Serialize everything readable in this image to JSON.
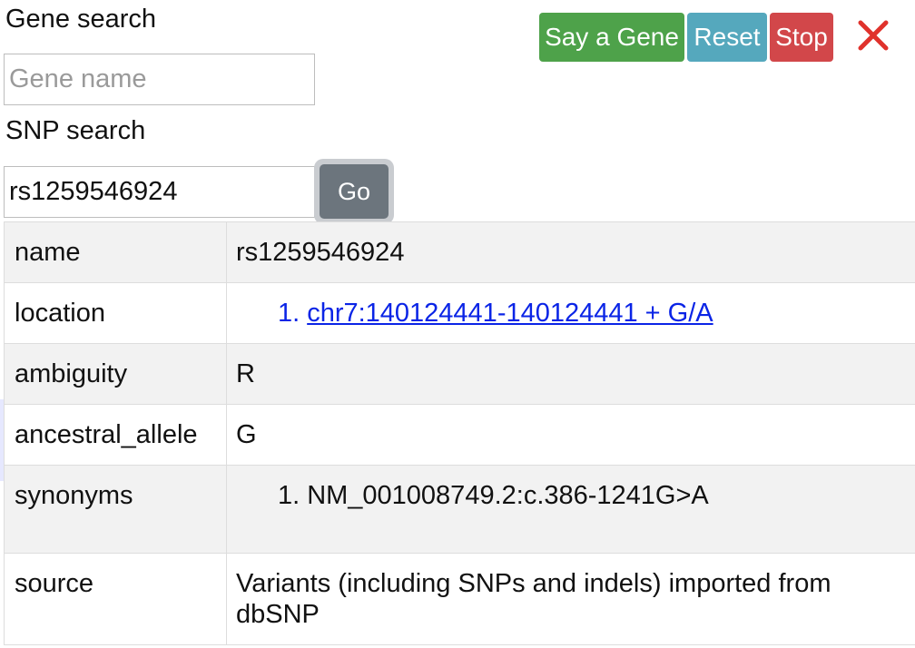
{
  "gene_search": {
    "label": "Gene search",
    "placeholder": "Gene name",
    "value": ""
  },
  "buttons": {
    "say_gene": "Say a Gene",
    "reset": "Reset",
    "stop": "Stop",
    "close_icon": "close-icon"
  },
  "snp_search": {
    "label": "SNP search",
    "value": "rs1259546924",
    "go": "Go"
  },
  "colors": {
    "say_gene": "#4ea24a",
    "reset": "#55a8bd",
    "stop": "#d2474a",
    "close": "#e0322c",
    "go": "#6c757d",
    "link": "#0a24e6"
  },
  "snp_info": {
    "name_key": "name",
    "name_value": "rs1259546924",
    "location_key": "location",
    "location_items": [
      {
        "num": "1.",
        "text": "chr7:140124441-140124441 + G/A"
      }
    ],
    "ambiguity_key": "ambiguity",
    "ambiguity_value": "R",
    "ancestral_key": "ancestral_allele",
    "ancestral_value": "G",
    "synonyms_key": "synonyms",
    "synonyms_items": [
      {
        "num": "1.",
        "text": "NM_001008749.2:c.386-1241G>A"
      }
    ],
    "source_key": "source",
    "source_value": "Variants (including SNPs and indels) imported from dbSNP"
  }
}
